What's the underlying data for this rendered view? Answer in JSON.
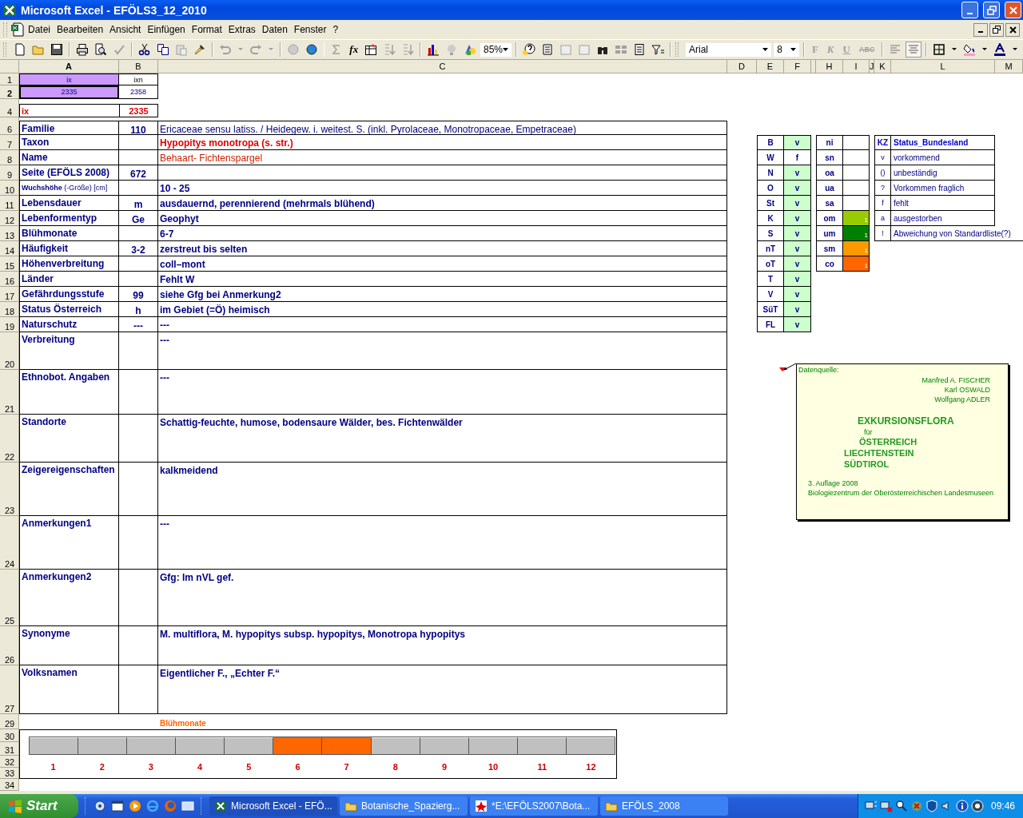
{
  "window": {
    "title": "Microsoft Excel - EFÖLS3_12_2010"
  },
  "menu": [
    "Datei",
    "Bearbeiten",
    "Ansicht",
    "Einfügen",
    "Format",
    "Extras",
    "Daten",
    "Fenster",
    "?"
  ],
  "toolbar": {
    "function_label": "fx",
    "zoom": "85%",
    "font": "Arial",
    "font_size": "8",
    "format_buttons": [
      "F",
      "K",
      "U",
      "ABC"
    ]
  },
  "columns": [
    "A",
    "B",
    "C",
    "D",
    "E",
    "F",
    "H",
    "I",
    "J",
    "K",
    "L",
    "M"
  ],
  "row_numbers": [
    "1",
    "2",
    "4",
    "6",
    "7",
    "8",
    "9",
    "10",
    "11",
    "12",
    "13",
    "14",
    "15",
    "16",
    "17",
    "18",
    "19",
    "20",
    "21",
    "22",
    "23",
    "24",
    "25",
    "26",
    "27",
    "29",
    "30",
    "31",
    "32",
    "33",
    "34"
  ],
  "index_cells": [
    {
      "label": "ix",
      "value": "2335",
      "highlight": true,
      "selected": true
    },
    {
      "label": "ixn",
      "value": "2358",
      "highlight": false,
      "selected": false
    }
  ],
  "current": {
    "label": "ix",
    "value": "2335"
  },
  "fields": [
    {
      "label": "Familie",
      "code": "110",
      "value": "Ericaceae sensu latiss.  /  Heidegew. i. weitest. S. (inkl. Pyrolaceae, Monotropaceae, Empetraceae)",
      "kind": "regular"
    },
    {
      "label": "Taxon",
      "value": "Hypopitys monotropa (s. str.)",
      "kind": "red-bold"
    },
    {
      "label": "Name",
      "value": "Behaart- Fichtenspargel",
      "kind": "red"
    },
    {
      "label": "Seite (EFÖLS 2008)",
      "code": "672",
      "kind": "bold"
    },
    {
      "label": "**Wuchshöhe** (-Größe) [cm]",
      "label_small": true,
      "value": "10 - 25",
      "kind": "bold"
    },
    {
      "label": "Lebensdauer",
      "code": "m",
      "value": "ausdauernd, perennierend (mehrmals blühend)",
      "kind": "bold"
    },
    {
      "label": "Lebenformentyp",
      "code": "Ge",
      "value": "Geophyt",
      "kind": "bold"
    },
    {
      "label": "Blühmonate",
      "value": "6-7",
      "kind": "bold"
    },
    {
      "label": "Häufigkeit",
      "code": "3-2",
      "value": "zerstreut bis selten",
      "kind": "bold"
    },
    {
      "label": "Höhenverbreitung",
      "value": "coll–mont",
      "kind": "bold"
    },
    {
      "label": "Länder",
      "value": "Fehlt W",
      "kind": "bold"
    },
    {
      "label": "Gefährdungsstufe",
      "code": "99",
      "value": "siehe Gfg bei Anmerkung2",
      "kind": "bold"
    },
    {
      "label": "Status Österreich",
      "code": "h",
      "value": "im Gebiet (=Ö) heimisch",
      "kind": "bold"
    },
    {
      "label": "Naturschutz",
      "code": "---",
      "value": "---",
      "kind": "bold"
    },
    {
      "label": "Verbreitung",
      "value": "---",
      "kind": "bold"
    },
    {
      "label": "Ethnobot. Angaben",
      "value": "---",
      "kind": "bold"
    },
    {
      "label": "Standorte",
      "value": "Schattig-feuchte, humose, bodensaure Wälder, bes. Fichtenwälder",
      "kind": "bold"
    },
    {
      "label": "Zeigereigenschaften",
      "value": "kalkmeidend",
      "kind": "bold"
    },
    {
      "label": "Anmerkungen1",
      "value": "---",
      "kind": "bold"
    },
    {
      "label": "Anmerkungen2",
      "value": "Gfg: Im nVL gef.",
      "kind": "bold"
    },
    {
      "label": "Synonyme",
      "value": "M. multiflora, M. hypopitys subsp. hypopitys, Monotropa hypopitys",
      "kind": "bold"
    },
    {
      "label": "Volksnamen",
      "value": "Eigentlicher F., „Echter F.“",
      "kind": "bold"
    }
  ],
  "regions": [
    {
      "code": "B",
      "value": "v",
      "present": true
    },
    {
      "code": "W",
      "value": "f",
      "present": false
    },
    {
      "code": "N",
      "value": "v",
      "present": true
    },
    {
      "code": "O",
      "value": "v",
      "present": true
    },
    {
      "code": "St",
      "value": "v",
      "present": true
    },
    {
      "code": "K",
      "value": "v",
      "present": true
    },
    {
      "code": "S",
      "value": "v",
      "present": true
    },
    {
      "code": "nT",
      "value": "v",
      "present": true
    },
    {
      "code": "oT",
      "value": "v",
      "present": true
    },
    {
      "code": "T",
      "value": "v",
      "present": true
    },
    {
      "code": "V",
      "value": "v",
      "present": true
    },
    {
      "code": "SüT",
      "value": "v",
      "present": true
    },
    {
      "code": "FL",
      "value": "v",
      "present": true
    }
  ],
  "altitudes": [
    {
      "code": "ni"
    },
    {
      "code": "sn"
    },
    {
      "code": "oa"
    },
    {
      "code": "ua"
    },
    {
      "code": "sa"
    },
    {
      "code": "om",
      "value": "1",
      "color": "#99cc00"
    },
    {
      "code": "um",
      "value": "1",
      "color": "#008000"
    },
    {
      "code": "sm",
      "value": "1",
      "color": "#ff9900"
    },
    {
      "code": "co",
      "value": "1",
      "color": "#ff6600"
    }
  ],
  "legend": {
    "header": [
      "KZ",
      "Status_Bundesland"
    ],
    "rows": [
      {
        "code": "v",
        "text": "vorkommend"
      },
      {
        "code": "()",
        "text": "unbeständig"
      },
      {
        "code": "?",
        "text": "Vorkommen fraglich"
      },
      {
        "code": "f",
        "text": "fehlt"
      },
      {
        "code": "a",
        "text": "ausgestorben"
      },
      {
        "code": "!",
        "text": "Abweichung von Standardliste(?)"
      }
    ]
  },
  "comment": {
    "label": "Datenquelle:",
    "authors": [
      "Manfred A. FISCHER",
      "Karl OSWALD",
      "Wolfgang ADLER"
    ],
    "title": "EXKURSIONSFLORA",
    "for": "für",
    "regions": [
      "ÖSTERREICH",
      "LIECHTENSTEIN",
      "SÜDTIROL"
    ],
    "edition": "3. Auflage 2008",
    "publisher": "Biologiezentrum der Oberösterreichischen Landesmuseen"
  },
  "bloom": {
    "title": "Blühmonate",
    "months": [
      {
        "label": "1",
        "on": false
      },
      {
        "label": "2",
        "on": false
      },
      {
        "label": "3",
        "on": false
      },
      {
        "label": "4",
        "on": false
      },
      {
        "label": "5",
        "on": false
      },
      {
        "label": "6",
        "on": true
      },
      {
        "label": "7",
        "on": true
      },
      {
        "label": "8",
        "on": false
      },
      {
        "label": "9",
        "on": false
      },
      {
        "label": "10",
        "on": false
      },
      {
        "label": "11",
        "on": false
      },
      {
        "label": "12",
        "on": false
      }
    ]
  },
  "taskbar": {
    "start": "Start",
    "tasks": [
      {
        "label": "Microsoft Excel - EFÖ...",
        "kind": "spreadsheet",
        "selected": true
      },
      {
        "label": "Botanische_Spazierg...",
        "kind": "folder",
        "selected": false
      },
      {
        "label": "*E:\\EFÖLS2007\\Bota...",
        "kind": "image",
        "selected": false
      },
      {
        "label": "EFÖLS_2008",
        "kind": "folder",
        "selected": false
      }
    ],
    "clock": "09:46"
  }
}
